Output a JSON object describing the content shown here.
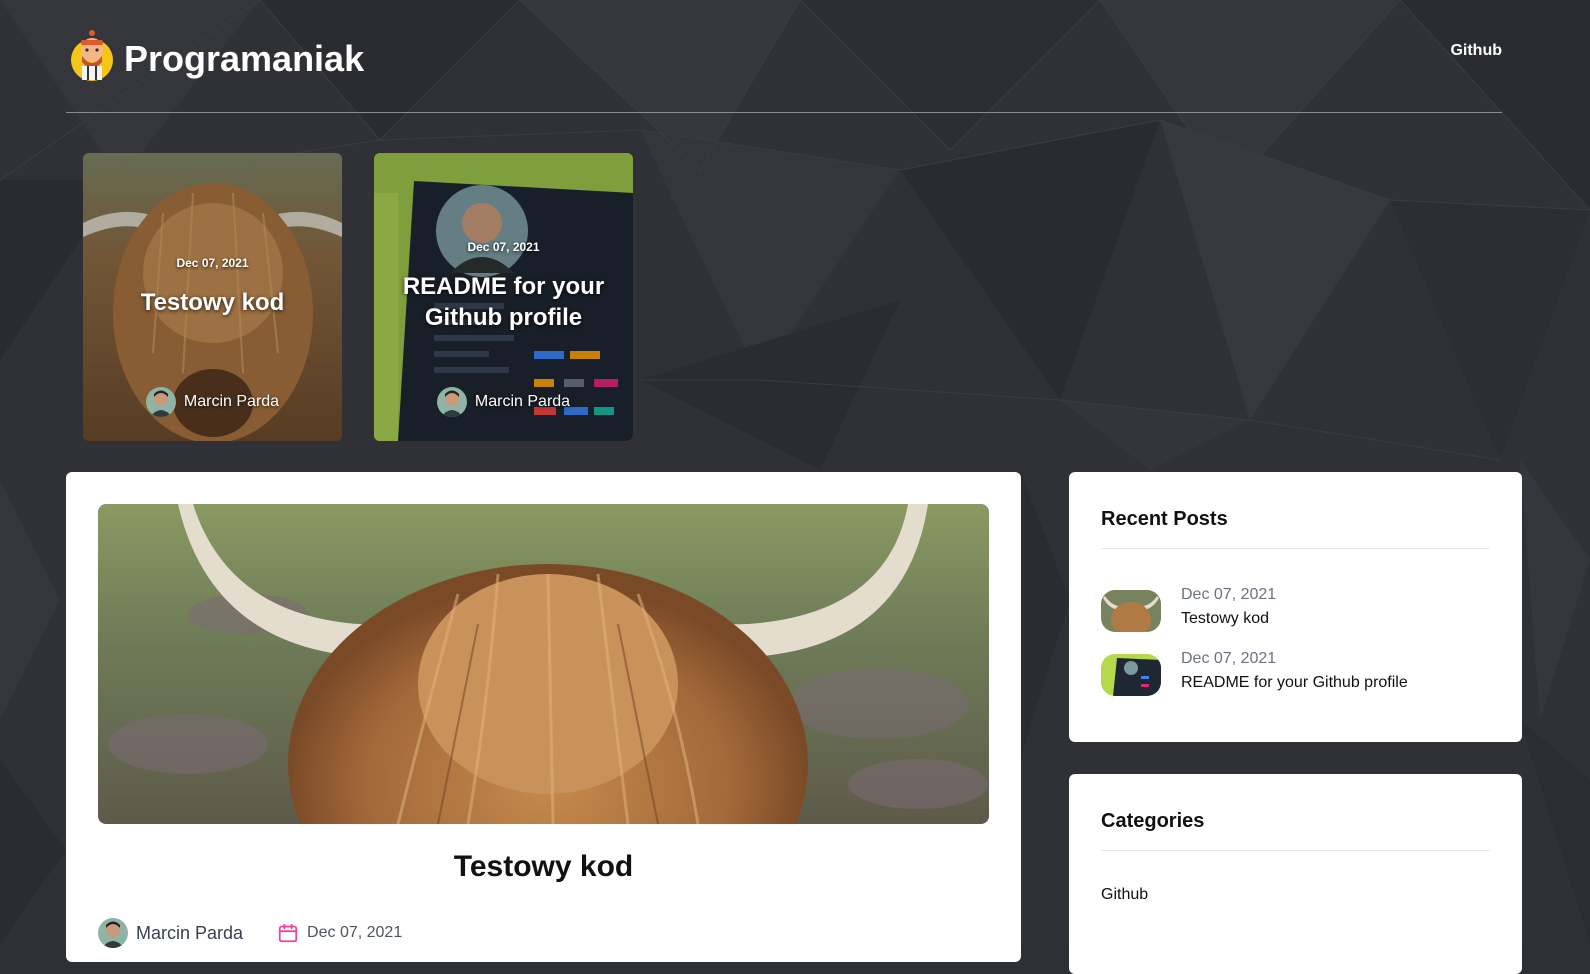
{
  "site": {
    "title": "Programaniak"
  },
  "nav": {
    "github_label": "Github"
  },
  "featured": [
    {
      "date": "Dec 07, 2021",
      "title": "Testowy kod",
      "author": "Marcin Parda"
    },
    {
      "date": "Dec 07, 2021",
      "title": "README for your Github profile",
      "author": "Marcin Parda"
    }
  ],
  "article": {
    "title": "Testowy kod",
    "author": "Marcin Parda",
    "date": "Dec 07, 2021"
  },
  "sidebar": {
    "recent_heading": "Recent Posts",
    "recent": [
      {
        "date": "Dec 07, 2021",
        "title": "Testowy kod"
      },
      {
        "date": "Dec 07, 2021",
        "title": "README for your Github profile"
      }
    ],
    "categories_heading": "Categories",
    "categories": [
      "Github"
    ]
  },
  "icons": {
    "calendar": "calendar-icon",
    "logo": "mascot-logo-icon"
  },
  "colors": {
    "background": "#2e3036",
    "accent_pink": "#ec4899",
    "card": "#ffffff"
  }
}
